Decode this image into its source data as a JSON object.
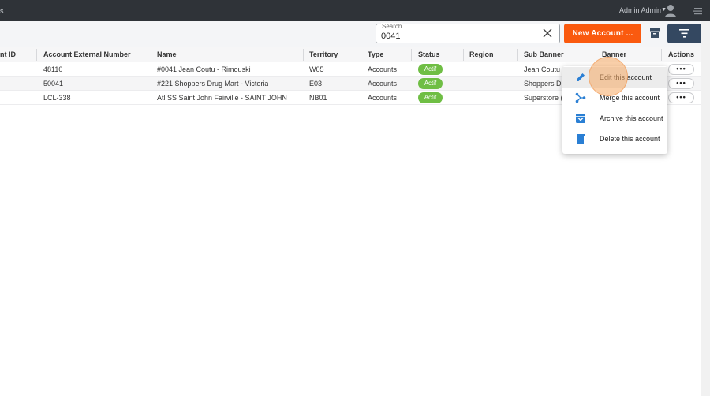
{
  "topbar": {
    "left_mark": "s",
    "user_name": "Admin Admin",
    "icons": {
      "caret": "caret-down-icon",
      "user": "user-icon",
      "menu": "menu-icon"
    }
  },
  "toolbar": {
    "search_label": "Search",
    "search_value": "0041",
    "new_account_label": "New Account ...",
    "colors": {
      "new_button": "#fa5a0f",
      "filter_button": "#344861"
    }
  },
  "table": {
    "columns": [
      "nt ID",
      "Account External Number",
      "Name",
      "Territory",
      "Type",
      "Status",
      "Region",
      "Sub Banner",
      "Banner",
      "Actions"
    ],
    "rows": [
      {
        "account_id": "",
        "external_number": "48110",
        "name": "#0041 Jean Coutu - Rimouski",
        "territory": "W05",
        "type": "Accounts",
        "status": "Actif",
        "region": "",
        "sub_banner": "Jean Coutu (",
        "banner": "",
        "actions": "•••"
      },
      {
        "account_id": "",
        "external_number": "50041",
        "name": "#221 Shoppers Drug Mart - Victoria",
        "territory": "E03",
        "type": "Accounts",
        "status": "Actif",
        "region": "",
        "sub_banner": "Shoppers Dr",
        "banner": "",
        "actions": "•••"
      },
      {
        "account_id": "",
        "external_number": "LCL-338",
        "name": "Atl SS Saint John Fairville - SAINT JOHN",
        "territory": "NB01",
        "type": "Accounts",
        "status": "Actif",
        "region": "",
        "sub_banner": "Superstore (2",
        "banner": "",
        "actions": "•••"
      }
    ],
    "status_color": "#6fbe44"
  },
  "dropdown": {
    "items": [
      {
        "label": "Edit this account",
        "icon": "pencil-icon"
      },
      {
        "label": "Merge this account",
        "icon": "merge-icon"
      },
      {
        "label": "Archive this account",
        "icon": "archive-icon"
      },
      {
        "label": "Delete this account",
        "icon": "trash-icon"
      }
    ],
    "icon_color": "#2a7fd4"
  }
}
